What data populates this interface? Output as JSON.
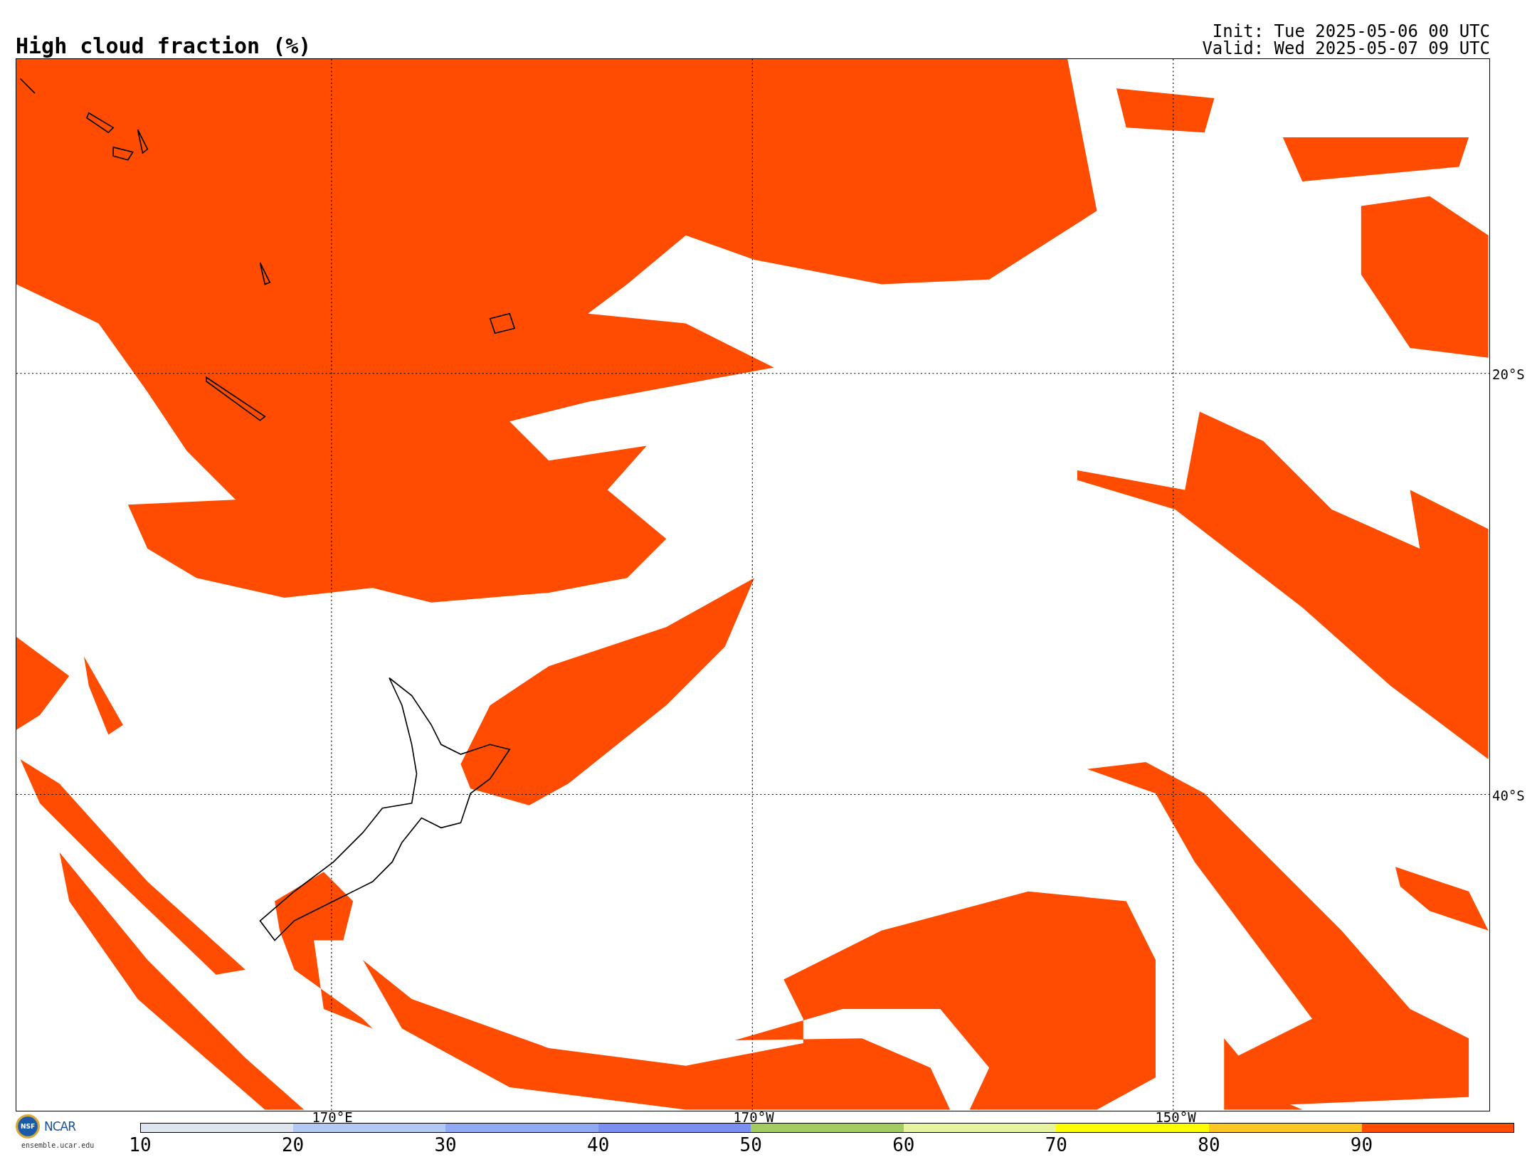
{
  "title": "High cloud fraction (%)",
  "run_info": {
    "init": "Init: Tue 2025-05-06 00 UTC",
    "valid": "Valid: Wed 2025-05-07 09 UTC"
  },
  "map": {
    "lat_labels": [
      "20°S",
      "40°S"
    ],
    "lon_labels": [
      "170°E",
      "170°W",
      "150°W"
    ]
  },
  "colorbar": [
    {
      "label": "10",
      "color": "#dde6ee"
    },
    {
      "label": "20",
      "color": "#b3c8f3"
    },
    {
      "label": "30",
      "color": "#8fa9f3"
    },
    {
      "label": "40",
      "color": "#7b8ff0"
    },
    {
      "label": "50",
      "color": "#a3cc60"
    },
    {
      "label": "60",
      "color": "#e8f3a0"
    },
    {
      "label": "70",
      "color": "#ffff00"
    },
    {
      "label": "80",
      "color": "#ffc820"
    },
    {
      "label": "90",
      "color": "#ff4c00"
    }
  ],
  "logo": {
    "seal": "NSF",
    "name": "NCAR",
    "url": "ensemble.ucar.edu"
  }
}
